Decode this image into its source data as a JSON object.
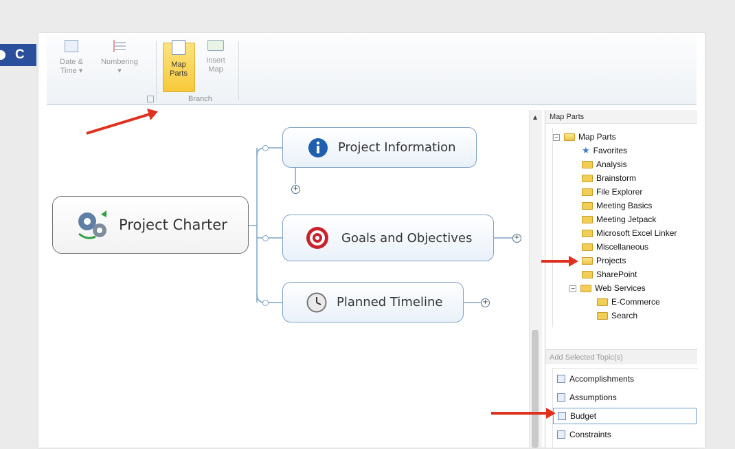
{
  "badge": {
    "label": "C"
  },
  "ribbon": {
    "buttons": [
      {
        "label_line1": "Date &",
        "label_line2": "Time ▾"
      },
      {
        "label_line1": "Numbering",
        "label_line2": "▾"
      },
      {
        "label_line1": "Map",
        "label_line2": "Parts"
      },
      {
        "label_line1": "Insert",
        "label_line2": "Map"
      }
    ],
    "group_label": "Branch"
  },
  "map": {
    "central": "Project Charter",
    "topics": [
      {
        "label": "Project Information"
      },
      {
        "label": "Goals and Objectives"
      },
      {
        "label": "Planned Timeline"
      }
    ],
    "expand_glyph": "+"
  },
  "panel": {
    "title": "Map Parts",
    "tree": {
      "root": "Map Parts",
      "favorites": "Favorites",
      "folders": [
        "Analysis",
        "Brainstorm",
        "File Explorer",
        "Meeting Basics",
        "Meeting Jetpack",
        "Microsoft Excel Linker",
        "Miscellaneous",
        "Projects",
        "SharePoint"
      ],
      "web_services": "Web Services",
      "web_children": [
        "E-Commerce",
        "Search"
      ],
      "collapse_glyph": "−"
    },
    "add_header": "Add Selected Topic(s)",
    "topics": [
      "Accomplishments",
      "Assumptions",
      "Budget",
      "Constraints"
    ]
  },
  "colors": {
    "accent": "#2b4f9a",
    "arrow": "#e0301e",
    "node_border": "#7fa3c7",
    "highlight": "#f8c93a"
  }
}
